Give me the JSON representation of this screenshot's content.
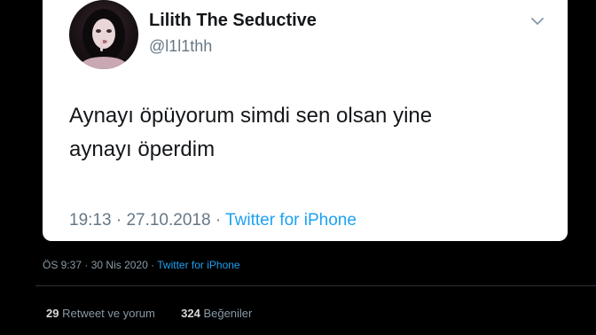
{
  "embedded_tweet": {
    "display_name": "Lilith The Seductive",
    "handle": "@l1l1thh",
    "text_lines": [
      "Aynayı öpüyorum simdi sen olsan yine",
      "aynayı öperdim"
    ],
    "time": "19:13",
    "date": "27.10.2018",
    "separator": "·",
    "source": "Twitter for iPhone",
    "avatar_icon": "profile-photo",
    "menu_icon": "chevron-down-icon"
  },
  "outer_tweet": {
    "time": "ÖS 9:37",
    "date": "30 Nis 2020",
    "separator": "·",
    "source": "Twitter for iPhone",
    "retweets_count": "29",
    "retweets_label": "Retweet ve yorum",
    "likes_count": "324",
    "likes_label": "Beğeniler"
  },
  "colors": {
    "background": "#000000",
    "card": "#ffffff",
    "link": "#1da1f2",
    "muted": "#657786"
  }
}
